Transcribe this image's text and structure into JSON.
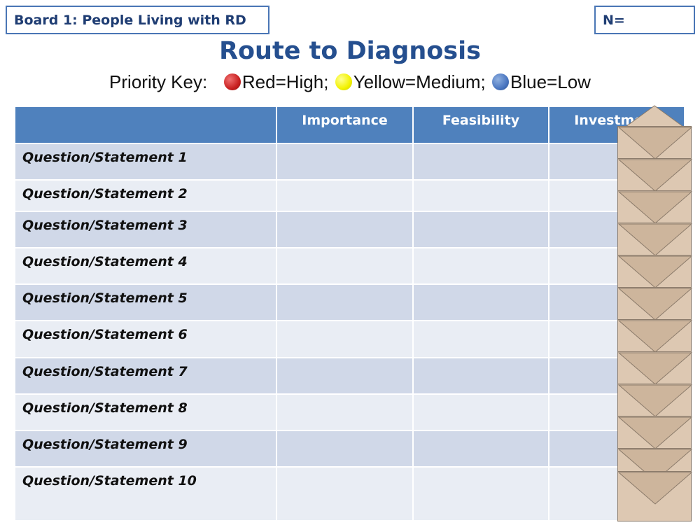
{
  "header": {
    "board_label": "Board 1: People Living with RD",
    "n_label": "N="
  },
  "title": "Route to Diagnosis",
  "priority_key": {
    "prefix": "Priority Key:",
    "items": [
      {
        "label": "Red=High;",
        "color": "#c82020"
      },
      {
        "label": "Yellow=Medium;",
        "color": "#f2f200"
      },
      {
        "label": "Blue=Low",
        "color": "#4a76c0"
      }
    ]
  },
  "table": {
    "columns": [
      "",
      "Importance",
      "Feasibility",
      "Investment"
    ],
    "rows": [
      "Question/Statement 1",
      "Question/Statement 2",
      "Question/Statement 3",
      "Question/Statement 4",
      "Question/Statement 5",
      "Question/Statement 6",
      "Question/Statement 7",
      "Question/Statement 8",
      "Question/Statement 9",
      "Question/Statement 10"
    ]
  },
  "colors": {
    "header_blue": "#4f81bd",
    "row_dark": "#d0d8e8",
    "row_light": "#e9edf4",
    "title_blue": "#254f8f",
    "envelope": "#ddc8b2"
  }
}
